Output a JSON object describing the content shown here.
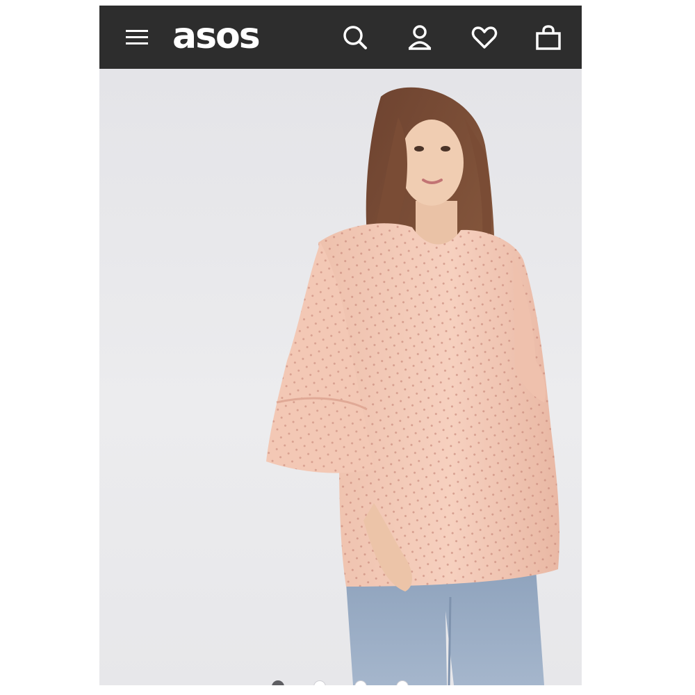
{
  "app": {
    "brand": "asos"
  },
  "header": {
    "menu_icon": "hamburger-menu-icon",
    "search_icon": "search-icon",
    "account_icon": "account-user-icon",
    "wishlist_icon": "heart-icon",
    "bag_icon": "shopping-bag-icon",
    "background_color": "#2d2d2d"
  },
  "product_gallery": {
    "image_description_icon": "product-photo",
    "slide_count": 4,
    "active_slide": 1,
    "colors": {
      "active_dot": "#5e5e62",
      "inactive_dot": "#ffffff"
    }
  }
}
